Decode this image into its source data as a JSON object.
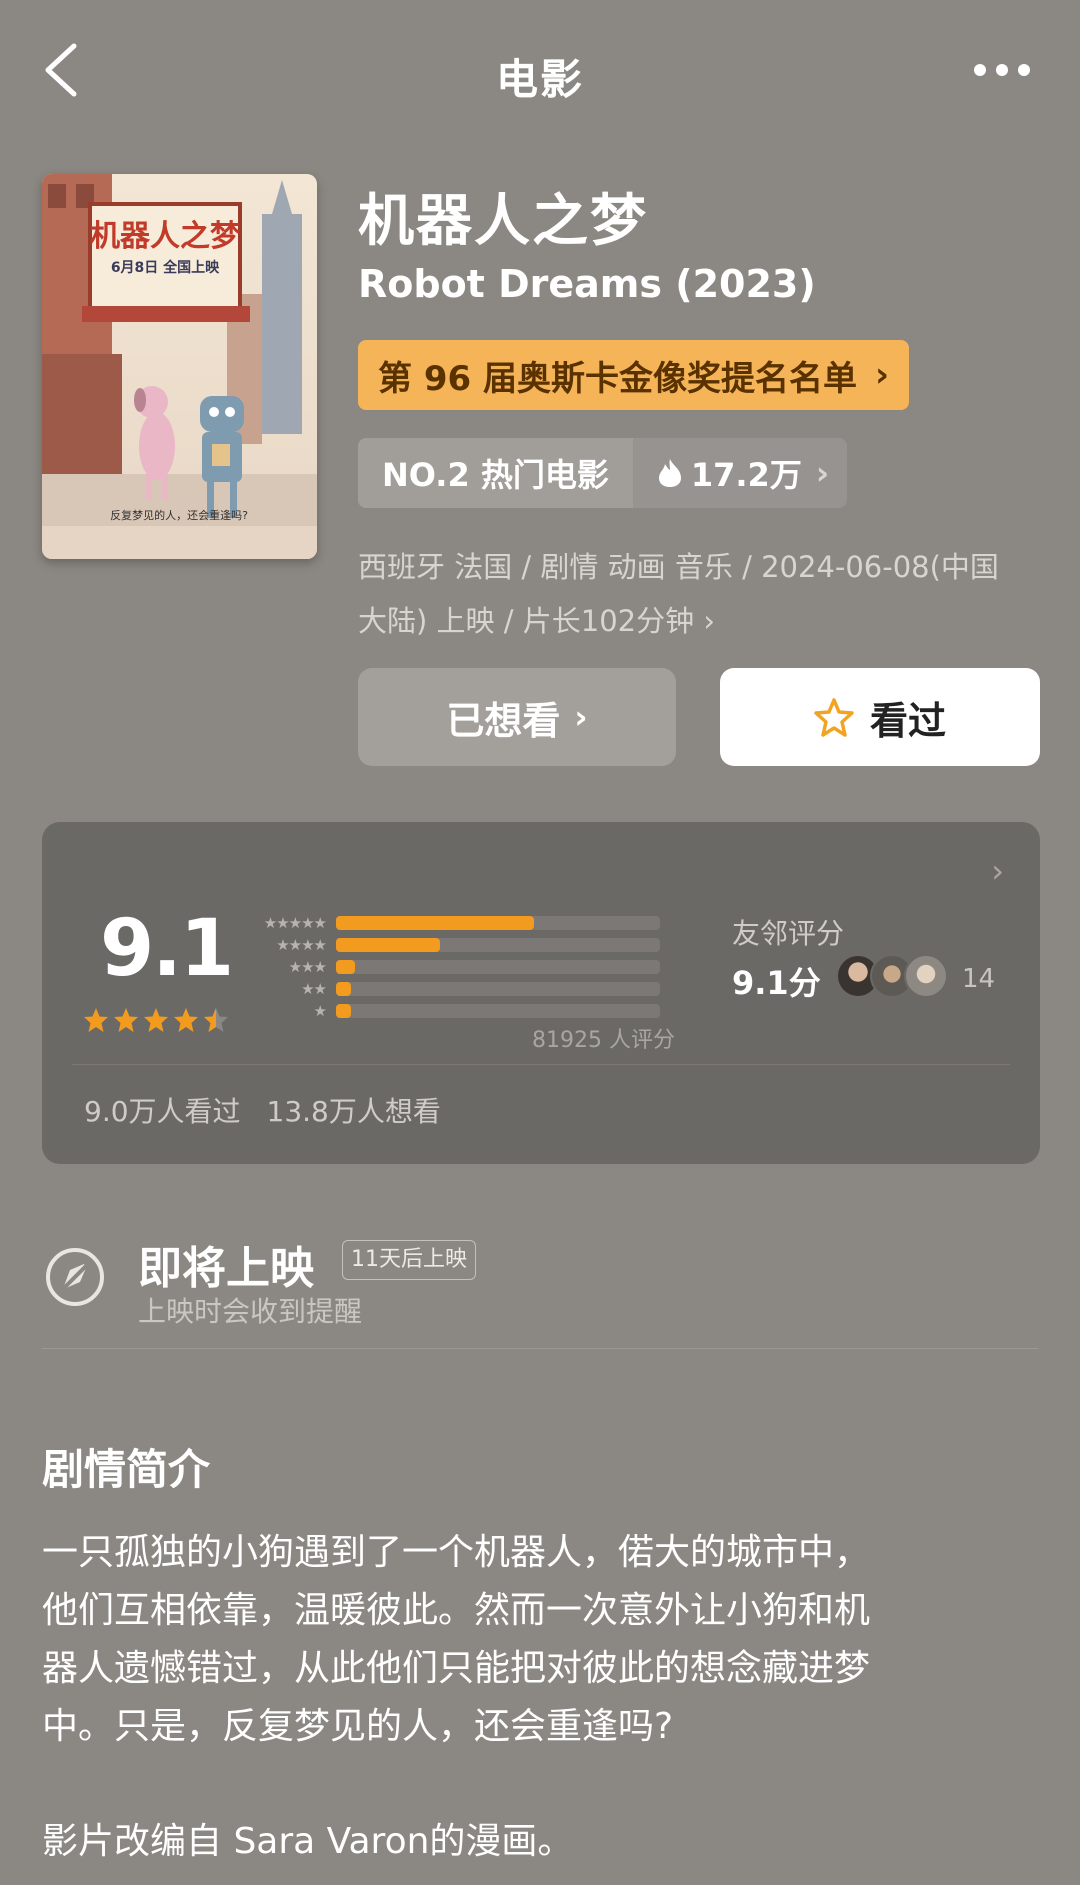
{
  "topbar": {
    "title": "电影"
  },
  "movie": {
    "title_cn": "机器人之梦",
    "title_en": "Robot Dreams (2023)",
    "poster": {
      "title": "机器人之梦",
      "date_line": "6月8日 全国上映",
      "tagline": "反复梦见的人，还会重逢吗?"
    },
    "award_label": "第 96 届奥斯卡金像奖提名名单",
    "rank_label": "NO.2 热门电影",
    "heat_value": "17.2万",
    "meta_line1": "西班牙 法国 / 剧情 动画 音乐 / 2024-06-08(中国",
    "meta_line2": "大陆) 上映 / 片长102分钟"
  },
  "actions": {
    "want_label": "已想看",
    "seen_label": "看过"
  },
  "rating": {
    "score": "9.1",
    "stars": 4.5,
    "distribution": [
      {
        "stars": 5,
        "fraction": 0.61
      },
      {
        "stars": 4,
        "fraction": 0.32
      },
      {
        "stars": 3,
        "fraction": 0.06
      },
      {
        "stars": 2,
        "fraction": 0.045
      },
      {
        "stars": 1,
        "fraction": 0.045
      }
    ],
    "count_text": "81925 人评分",
    "friends_label": "友邻评分",
    "friends_score": "9.1分",
    "friends_count": "14",
    "watched_text": "9.0万人看过",
    "want_text": "13.8万人想看"
  },
  "upcoming": {
    "title": "即将上映",
    "badge": "11天后上映",
    "subtitle": "上映时会收到提醒"
  },
  "synopsis": {
    "title": "剧情简介",
    "lines": [
      "一只孤独的小狗遇到了一个机器人，偌大的城市中，",
      "他们互相依靠，温暖彼此。然而一次意外让小狗和机",
      "器人遗憾错过，从此他们只能把对彼此的想念藏进梦",
      "中。只是，反复梦见的人，还会重逢吗?"
    ],
    "note": "影片改编自 Sara Varon的漫画。"
  },
  "colors": {
    "background": "#8b8782",
    "accent_orange": "#f29b1e",
    "award_bg": "#f5b457",
    "card_bg": "#6b6966"
  },
  "icons": [
    "back-icon",
    "more-icon",
    "fire-icon",
    "star-outline-icon",
    "star-icon",
    "bell-off-icon"
  ]
}
